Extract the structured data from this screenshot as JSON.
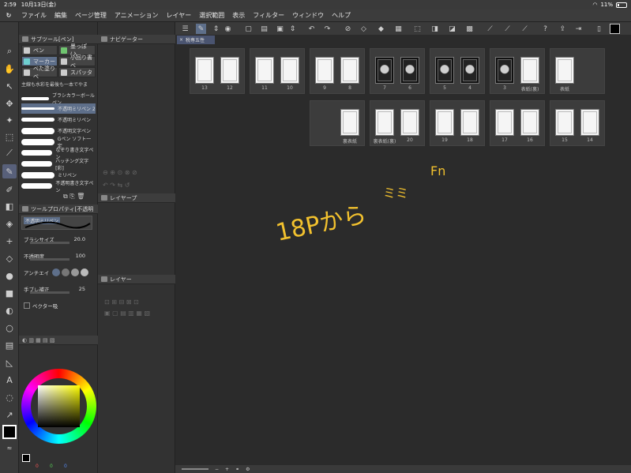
{
  "status": {
    "time": "2:59",
    "date": "10月13日(金)",
    "battery": "11%"
  },
  "menu": [
    "ファイル",
    "編集",
    "ページ管理",
    "アニメーション",
    "レイヤー",
    "選択範囲",
    "表示",
    "フィルター",
    "ウィンドウ",
    "ヘルプ"
  ],
  "panels": {
    "subtool_title": "サブツール[ペン]",
    "navigator_title": "ナビゲーター",
    "layer_prop_title": "レイヤープ",
    "layer_title": "レイヤー",
    "tool_prop_title": "ツールプロパティ[不透明",
    "doc_tab": "税専五性"
  },
  "subtool_tabs": [
    {
      "label": "ペン",
      "color": "#cccccc"
    },
    {
      "label": "墨っぽ (入",
      "color": "#6fc46f"
    },
    {
      "label": "マーカー",
      "color": "#6fd0d0"
    },
    {
      "label": "小回り書べ",
      "color": "#cccccc"
    },
    {
      "label": "べた塗りべ",
      "color": "#cccccc"
    },
    {
      "label": "スパッタ",
      "color": "#cccccc"
    }
  ],
  "brush_list_header": "主線も水彩を最後も一本でやま",
  "brushes": [
    "ブラシカラーボールペン",
    "不透明ミリペン 2",
    "不透明ミリペン",
    "不透明文字ペン",
    "Gペン ソフト一定",
    "なぞり書き文字ペン",
    "ハッチング文字 [彩]",
    "ミリペン",
    "不透明書き文字ペン",
    "不透明ミリペン"
  ],
  "brush_selected": 1,
  "tool_props": {
    "brush_name": "不透明ミリペン",
    "brush_size_label": "ブラシサイズ",
    "brush_size_value": "20.0",
    "opacity_label": "不透明度",
    "opacity_value": "100",
    "antialias_label": "アンチエイ",
    "stabilize_label": "手ブレ補正",
    "stabilize_value": "25",
    "vector_label": "ベクター吸"
  },
  "color_values": [
    "0",
    "0",
    "0"
  ],
  "pages_row1": [
    {
      "labels": [
        "13",
        "12"
      ],
      "dark": [
        false,
        false
      ]
    },
    {
      "labels": [
        "11",
        "10"
      ],
      "dark": [
        false,
        false
      ]
    },
    {
      "labels": [
        "9",
        "8"
      ],
      "dark": [
        false,
        false
      ]
    },
    {
      "labels": [
        "7",
        "6"
      ],
      "dark": [
        true,
        true
      ]
    },
    {
      "labels": [
        "5",
        "4"
      ],
      "dark": [
        true,
        true
      ]
    },
    {
      "labels": [
        "3",
        "表紙(裏)"
      ],
      "dark": [
        true,
        false
      ]
    },
    {
      "labels": [
        "表紙"
      ],
      "dark": [
        false
      ]
    }
  ],
  "pages_row2": [
    {
      "labels": [
        "裏表紙"
      ],
      "dark": [
        false
      ]
    },
    {
      "labels": [
        "裏表紙(裏)",
        "20"
      ],
      "dark": [
        false,
        false
      ]
    },
    {
      "labels": [
        "19",
        "18"
      ],
      "dark": [
        false,
        false
      ]
    },
    {
      "labels": [
        "17",
        "16"
      ],
      "dark": [
        false,
        false
      ]
    },
    {
      "labels": [
        "15",
        "14"
      ],
      "dark": [
        false,
        false
      ]
    }
  ],
  "annotation": {
    "line1": "18Pから",
    "line2": "ミミ",
    "line3": "Fn"
  },
  "colors": {
    "annotation": "#f2c12e",
    "accent": "#5e6f8a"
  }
}
